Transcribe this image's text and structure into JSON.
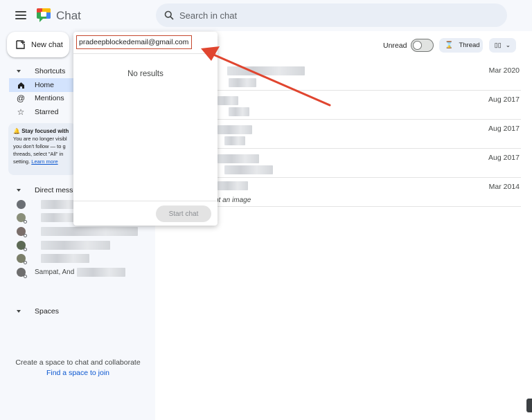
{
  "header": {
    "app_title": "Chat",
    "search_placeholder": "Search in chat",
    "menu_icon": "hamburger-icon",
    "logo_icon": "google-chat-logo",
    "search_icon": "search-icon"
  },
  "sidebar": {
    "new_chat_label": "New chat",
    "shortcuts_label": "Shortcuts",
    "nav": [
      {
        "label": "Home",
        "icon": "home-icon",
        "active": true
      },
      {
        "label": "Mentions",
        "icon": "at-icon",
        "active": false
      },
      {
        "label": "Starred",
        "icon": "star-icon",
        "active": false
      }
    ],
    "notice": {
      "title": "Stay focused with",
      "line1": "You are no longer visibl",
      "line2": "you don't follow — to g",
      "line3": "threads, select \"All\" in",
      "line4_prefix": "setting.",
      "learn_more": "Learn more"
    },
    "direct_messages_label": "Direct mess",
    "dm_last_visible": "Sampat, And",
    "spaces_label": "Spaces",
    "spaces_empty_text": "Create a space to chat and collaborate",
    "find_space_link": "Find a space to join"
  },
  "main": {
    "unread_label": "Unread",
    "unread_on": false,
    "thread_label": "Thread",
    "conversations": [
      {
        "date": "Mar 2020",
        "snippet": ""
      },
      {
        "date": "Aug 2017",
        "snippet": ""
      },
      {
        "date": "Aug 2017",
        "snippet": ""
      },
      {
        "date": "Aug 2017",
        "snippet": ""
      },
      {
        "date": "Mar 2014",
        "snippet": "nt an image"
      }
    ]
  },
  "dropdown": {
    "input_value": "pradeepblockedemail@gmail.com",
    "no_results": "No results",
    "start_chat_label": "Start chat"
  },
  "colors": {
    "accent_blue": "#0b57d0",
    "active_nav_bg": "#d3e3fd",
    "annotation_red": "#e0452f"
  }
}
